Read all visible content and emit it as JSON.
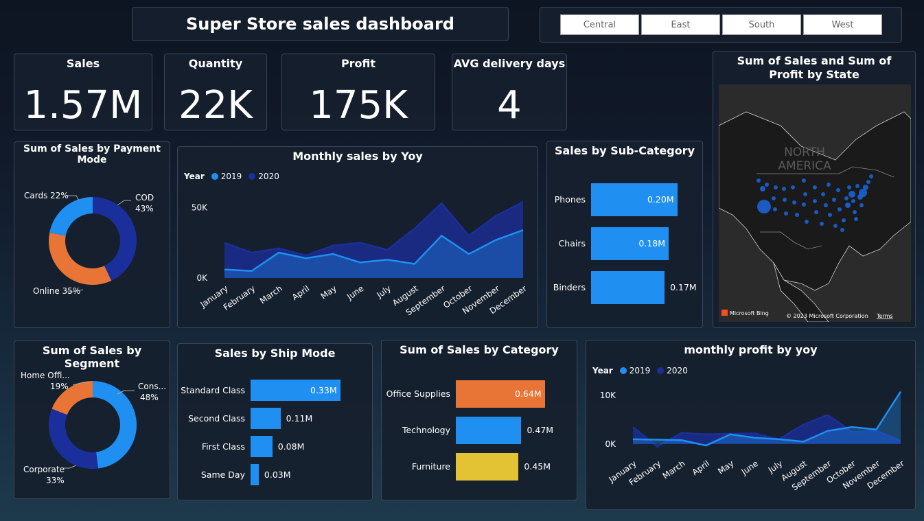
{
  "header": {
    "title": "Super Store sales dashboard"
  },
  "slicer": {
    "regions": [
      "Central",
      "East",
      "South",
      "West"
    ]
  },
  "kpis": {
    "sales": {
      "label": "Sales",
      "value": "1.57M"
    },
    "quantity": {
      "label": "Quantity",
      "value": "22K"
    },
    "profit": {
      "label": "Profit",
      "value": "175K"
    },
    "delivery": {
      "label": "AVG delivery days",
      "value": "4"
    }
  },
  "map": {
    "title": "Sum of Sales and Sum of Profit by State",
    "region_label": "NORTH AMERICA",
    "region_label_1": "NORTH",
    "region_label_2": "AMERICA",
    "attribution": "Microsoft Bing",
    "copyright": "© 2023 Microsoft Corporation",
    "terms": "Terms"
  },
  "colors": {
    "blue": "#1f8ff2",
    "navy": "#1b2f9c",
    "orange": "#e87436",
    "yellow": "#e3c234"
  },
  "chart_data": [
    {
      "id": "payment_mode",
      "type": "pie",
      "title": "Sum of Sales by Payment Mode",
      "labels": [
        "COD",
        "Online",
        "Cards"
      ],
      "values": [
        43,
        35,
        22
      ],
      "label_text": [
        "COD",
        "43%",
        "Online 35%",
        "Cards 22%"
      ],
      "colors": [
        "#1b2f9c",
        "#e87436",
        "#1f8ff2"
      ]
    },
    {
      "id": "monthly_sales",
      "type": "area",
      "title": "Monthly sales by Yoy",
      "legend_title": "Year",
      "categories": [
        "January",
        "February",
        "March",
        "April",
        "May",
        "June",
        "July",
        "August",
        "September",
        "October",
        "November",
        "December"
      ],
      "series": [
        {
          "name": "2020",
          "values": [
            25000,
            18000,
            21000,
            16000,
            23000,
            25000,
            20000,
            35000,
            53000,
            30000,
            44000,
            54000
          ]
        },
        {
          "name": "2019",
          "values": [
            6000,
            5000,
            18000,
            14000,
            17000,
            11000,
            13000,
            10000,
            30000,
            17000,
            27000,
            34000
          ]
        }
      ],
      "y_ticks": [
        "0K",
        "50K"
      ],
      "ylim": [
        0,
        55000
      ]
    },
    {
      "id": "sub_category",
      "type": "bar",
      "title": "Sales by Sub-Category",
      "categories": [
        "Phones",
        "Chairs",
        "Binders"
      ],
      "values": [
        0.2,
        0.18,
        0.17
      ],
      "value_labels": [
        "0.20M",
        "0.18M",
        "0.17M"
      ]
    },
    {
      "id": "segment",
      "type": "pie",
      "title": "Sum of Sales by Segment",
      "labels": [
        "Consumer",
        "Corporate",
        "Home Office"
      ],
      "values": [
        48,
        33,
        19
      ],
      "label_text": [
        "Cons...",
        "48%",
        "Corporate",
        "33%",
        "Home Offi...",
        "19%"
      ],
      "colors": [
        "#1f8ff2",
        "#1b2f9c",
        "#e87436"
      ]
    },
    {
      "id": "ship_mode",
      "type": "bar",
      "title": "Sales by Ship Mode",
      "categories": [
        "Standard Class",
        "Second Class",
        "First Class",
        "Same Day"
      ],
      "values": [
        0.33,
        0.11,
        0.08,
        0.03
      ],
      "value_labels": [
        "0.33M",
        "0.11M",
        "0.08M",
        "0.03M"
      ]
    },
    {
      "id": "category",
      "type": "bar",
      "title": "Sum of Sales by Category",
      "categories": [
        "Office Supplies",
        "Technology",
        "Furniture"
      ],
      "values": [
        0.64,
        0.47,
        0.45
      ],
      "value_labels": [
        "0.64M",
        "0.47M",
        "0.45M"
      ],
      "colors": [
        "#e87436",
        "#1f8ff2",
        "#e3c234"
      ]
    },
    {
      "id": "monthly_profit",
      "type": "area",
      "title": "monthly profit by yoy",
      "legend_title": "Year",
      "categories": [
        "January",
        "February",
        "March",
        "April",
        "May",
        "June",
        "July",
        "August",
        "September",
        "October",
        "November",
        "December"
      ],
      "series": [
        {
          "name": "2020",
          "values": [
            3500,
            -500,
            2300,
            2000,
            2100,
            2200,
            1000,
            4000,
            6000,
            2500,
            2700,
            700
          ]
        },
        {
          "name": "2019",
          "values": [
            1000,
            900,
            800,
            -300,
            2000,
            1300,
            1000,
            500,
            2700,
            3500,
            3000,
            10800
          ]
        }
      ],
      "y_ticks": [
        "0K",
        "10K"
      ],
      "ylim": [
        -1000,
        11000
      ]
    }
  ]
}
